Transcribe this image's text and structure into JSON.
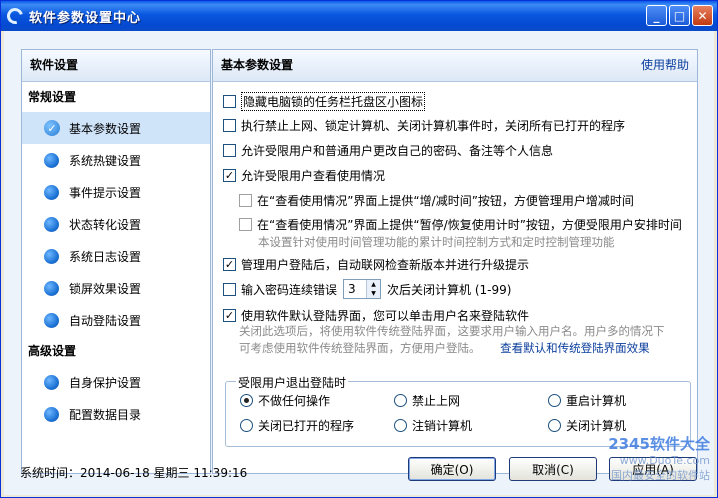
{
  "window": {
    "title": "软件参数设置中心",
    "min_icon": "_",
    "max_icon": "□",
    "close_icon": "✕"
  },
  "sidebar": {
    "header": "软件设置",
    "group1": "常规设置",
    "items1": [
      {
        "label": "基本参数设置",
        "icon": "check-circle-icon"
      },
      {
        "label": "系统热键设置",
        "icon": "blue-dot-icon"
      },
      {
        "label": "事件提示设置",
        "icon": "blue-dot-icon"
      },
      {
        "label": "状态转化设置",
        "icon": "blue-dot-icon"
      },
      {
        "label": "系统日志设置",
        "icon": "blue-dot-icon"
      },
      {
        "label": "锁屏效果设置",
        "icon": "blue-dot-icon"
      },
      {
        "label": "自动登陆设置",
        "icon": "blue-dot-icon"
      }
    ],
    "group2": "高级设置",
    "items2": [
      {
        "label": "自身保护设置",
        "icon": "blue-dot-icon"
      },
      {
        "label": "配置数据目录",
        "icon": "blue-dot-icon"
      }
    ]
  },
  "main": {
    "header": "基本参数设置",
    "help": "使用帮助",
    "options": {
      "o1": {
        "label": "隐藏电脑锁的任务栏托盘区小图标",
        "checked": false
      },
      "o2": {
        "label": "执行禁止上网、锁定计算机、关闭计算机事件时，关闭所有已打开的程序",
        "checked": false
      },
      "o3": {
        "label": "允许受限用户和普通用户更改自己的密码、备注等个人信息",
        "checked": false
      },
      "o4": {
        "label": "允许受限用户查看使用情况",
        "checked": true
      },
      "o5": {
        "label": "在“查看使用情况”界面上提供“增/减时间”按钮，方便管理用户增减时间",
        "checked": false
      },
      "o6": {
        "label": "在“查看使用情况”界面上提供“暂停/恢复使用计时”按钮，方便受限用户安排时间",
        "checked": false
      },
      "o6_hint": "本设置针对使用时间管理功能的累计时间控制方式和定时控制管理功能",
      "o7": {
        "label": "管理用户登陆后，自动联网检查新版本并进行升级提示",
        "checked": true
      },
      "o8": {
        "label_before": "输入密码连续错误",
        "value": "3",
        "label_after": "次后关闭计算机  (1-99)",
        "checked": false
      },
      "o9": {
        "label": "使用软件默认登陆界面，您可以单击用户名来登陆软件",
        "checked": true
      },
      "o9_hint1": "关闭此选项后，将使用软件传统登陆界面，这要求用户输入用户名。用户多的情况下",
      "o9_hint2": "可考虑使用软件传统登陆界面，方便用户登陆。",
      "o9_link": "查看默认和传统登陆界面效果"
    },
    "exit_group": {
      "title": "受限用户退出登陆时",
      "radios": [
        {
          "label": "不做任何操作",
          "checked": true
        },
        {
          "label": "禁止上网",
          "checked": false
        },
        {
          "label": "重启计算机",
          "checked": false
        },
        {
          "label": "关闭已打开的程序",
          "checked": false
        },
        {
          "label": "注销计算机",
          "checked": false
        },
        {
          "label": "关闭计算机",
          "checked": false
        }
      ]
    }
  },
  "status": {
    "time": "系统时间：2014-06-18  星期三  11:39:16"
  },
  "buttons": {
    "ok": "确定(O)",
    "cancel": "取消(C)",
    "apply": "应用(A)"
  },
  "watermark": {
    "main": "2345软件大全",
    "sub": "国内最安全的软件站",
    "url": "www.DuoTe.com",
    "mid": "www.DuoTe.com"
  },
  "colors": {
    "title_blue": "#0A58E0",
    "panel_border": "#9DB7D8",
    "selected_row": "#CFE3F9",
    "link": "#0C3E9E"
  }
}
